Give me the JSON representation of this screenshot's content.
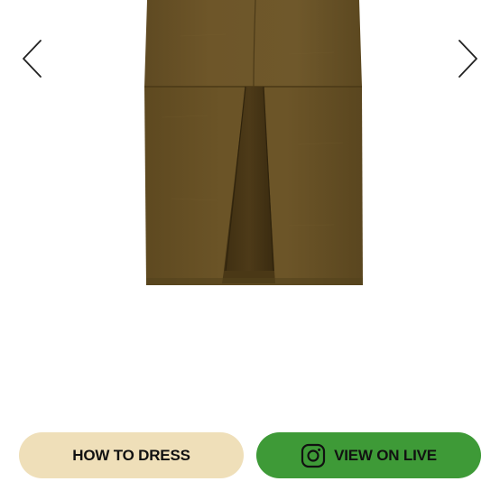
{
  "gallery": {
    "image_alt": "Suede midi skirt with front slit",
    "prev_icon": "chevron-left-icon",
    "next_icon": "chevron-right-icon",
    "colors": {
      "suede": "#6b5427",
      "background": "#ffffff"
    }
  },
  "actions": {
    "how_to_dress": {
      "label": "HOW TO DRESS",
      "color": "#efdfb9"
    },
    "view_on_live": {
      "label": "VIEW ON LIVE",
      "icon": "instagram-icon",
      "color": "#3e9a37"
    }
  }
}
